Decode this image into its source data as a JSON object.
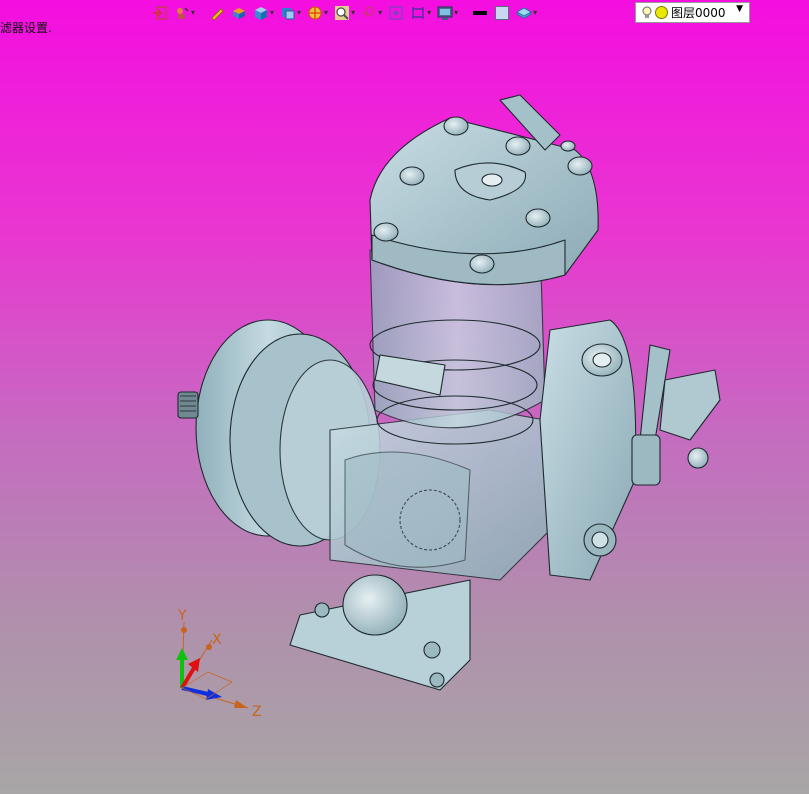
{
  "status": {
    "text": "滤器设置."
  },
  "toolbar": {
    "items": [
      {
        "name": "exit-sketch-icon",
        "dropdown": false
      },
      {
        "name": "sketch-tools-icon",
        "dropdown": true
      },
      {
        "name": "pencil-icon",
        "dropdown": false
      },
      {
        "name": "layers-cube-icon",
        "dropdown": false
      },
      {
        "name": "shaded-cube-icon",
        "dropdown": true
      },
      {
        "name": "view-cube-icon",
        "dropdown": true
      },
      {
        "name": "section-icon",
        "dropdown": true
      },
      {
        "name": "zoom-fit-icon",
        "dropdown": true
      },
      {
        "name": "rotate-icon",
        "dropdown": true
      },
      {
        "name": "snap-icon",
        "dropdown": false
      },
      {
        "name": "frame-icon",
        "dropdown": true
      },
      {
        "name": "display-icon",
        "dropdown": true
      },
      {
        "name": "line-style-icon",
        "dropdown": false
      },
      {
        "name": "color-swatch-icon",
        "dropdown": false
      },
      {
        "name": "layer-plane-icon",
        "dropdown": true
      }
    ],
    "colors": {
      "accent": "#e07800",
      "swatch": "#c8d8f0"
    }
  },
  "layer": {
    "value": "图层0000"
  },
  "triad": {
    "x_label": "X",
    "y_label": "Y",
    "z_label": "Z"
  }
}
